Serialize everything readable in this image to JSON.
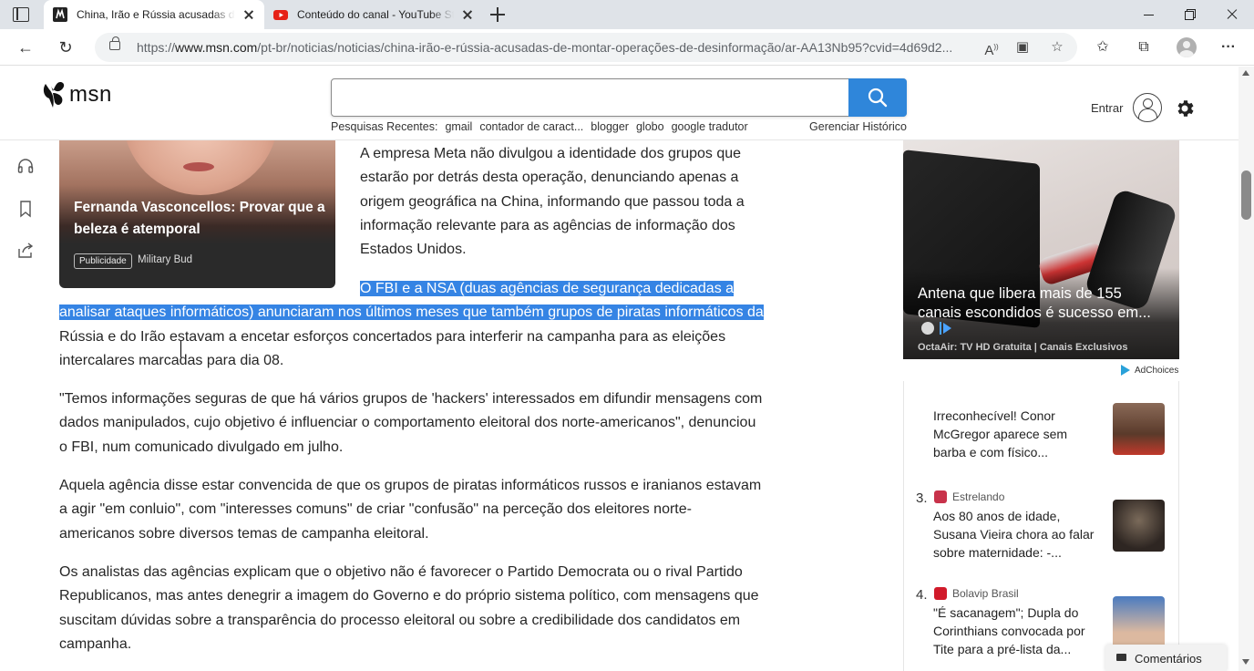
{
  "browser": {
    "tabs": [
      {
        "title": "China, Irão e Rússia acusadas de montar operações de desinformação",
        "active": true
      },
      {
        "title": "Conteúdo do canal - YouTube Studio",
        "active": false
      }
    ],
    "url_prefix": "https://",
    "url_domain": "www.msn.com",
    "url_path": "/pt-br/noticias/noticias/china-irão-e-rússia-acusadas-de-montar-operações-de-desinformação/ar-AA13Nb95?cvid=4d69d2...",
    "accent": "#2f86da"
  },
  "header": {
    "logo_text": "msn",
    "search": {
      "placeholder": "",
      "value": ""
    },
    "recent_label": "Pesquisas Recentes:",
    "recent": [
      "gmail",
      "contador de caract...",
      "blogger",
      "globo",
      "google tradutor"
    ],
    "manage_history": "Gerenciar Histórico",
    "signin": "Entrar"
  },
  "promo": {
    "title": "Fernanda Vasconcellos: Provar que a beleza é atemporal",
    "badge": "Publicidade",
    "source": "Military Bud"
  },
  "article": {
    "p1": "A empresa Meta não divulgou a identidade dos grupos que estarão por detrás desta operação, denunciando apenas a origem geográfica na China, informando que passou toda a informação relevante para as agências de informação dos Estados Unidos.",
    "p2_selected": "O FBI e a NSA (duas agências de segurança dedicadas a analisar ataques informáticos) anunciaram nos últimos meses que também grupos de piratas informáticos da ",
    "p2_rest": "Rússia e do Irão estavam a encetar esforços concertados para interferir na campanha para as eleições intercalares marcadas para dia 08.",
    "p3": "\"Temos informações seguras de que há vários grupos de 'hackers' interessados em difundir mensagens com dados manipulados, cujo objetivo é influenciar o comportamento eleitoral dos norte-americanos\", denunciou o FBI, num comunicado divulgado em julho.",
    "p4": "Aquela agência disse estar convencida de que os grupos de piratas informáticos russos e iranianos estavam a agir \"em conluio\", com \"interesses comuns\" de criar \"confusão\" na perceção dos eleitores norte-americanos sobre diversos temas de campanha eleitoral.",
    "p5": "Os analistas das agências explicam que o objetivo não é favorecer o Partido Democrata ou o rival Partido Republicanos, mas antes denegrir a imagem do Governo e do próprio sistema político, com mensagens que suscitam dúvidas sobre a transparência do processo eleitoral ou sobre a credibilidade dos candidatos em campanha."
  },
  "ad": {
    "title": "Antena que libera mais de 155 canais escondidos é sucesso em...",
    "source": "OctaAir: TV HD Gratuita | Canais Exclusivos",
    "adchoices": "AdChoices"
  },
  "trending": [
    {
      "number": "",
      "source": "",
      "title": "Irreconhecível! Conor McGregor aparece sem barba e com físico...",
      "icon_color": "#e0a0a0",
      "thumb_color": "#7a5a4a"
    },
    {
      "number": "3.",
      "source": "Estrelando",
      "title": "Aos 80 anos de idade, Susana Vieira chora ao falar sobre maternidade: -...",
      "icon_color": "#c8324a",
      "thumb_color": "#4a4038"
    },
    {
      "number": "4.",
      "source": "Bolavip Brasil",
      "title": "\"É sacanagem\"; Dupla do Corinthians convocada por Tite para a pré-lista da...",
      "icon_color": "#d11a2a",
      "thumb_color": "#3a6aa8"
    }
  ],
  "comments_label": "Comentários"
}
